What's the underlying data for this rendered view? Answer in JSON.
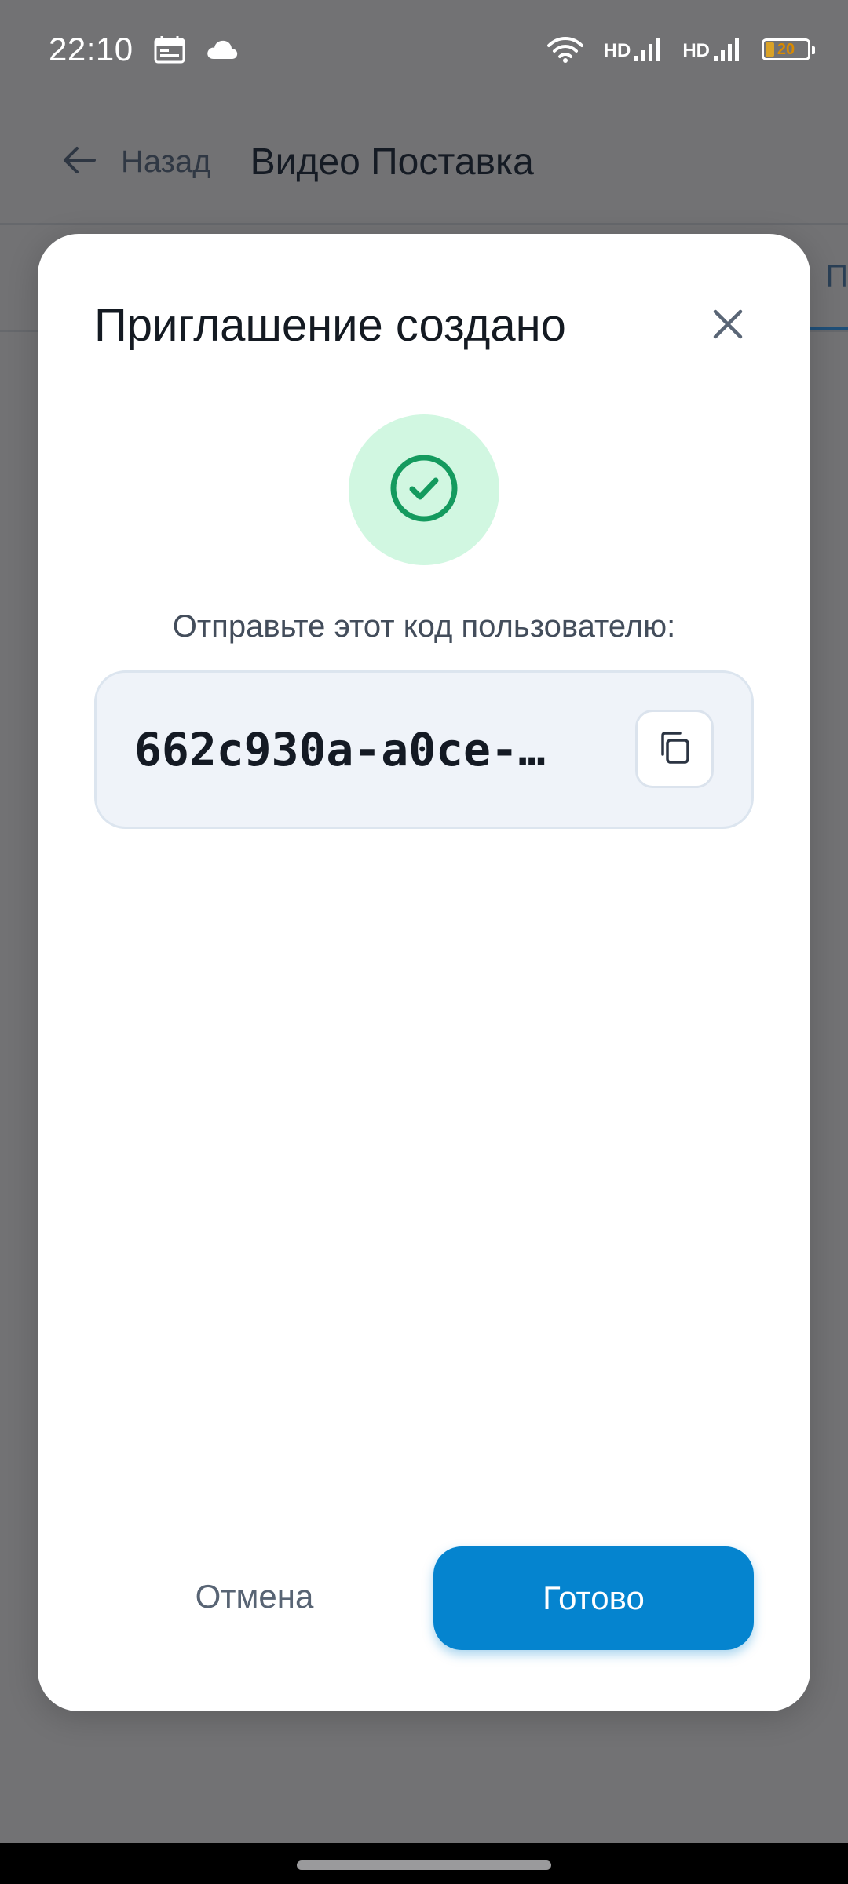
{
  "status_bar": {
    "time": "22:10",
    "network_1": "HD",
    "network_2": "HD",
    "battery_level": "20",
    "icons": [
      "calendar-icon",
      "cloud-icon",
      "wifi-icon",
      "signal-icon",
      "battery-icon"
    ]
  },
  "screen": {
    "back_label": "Назад",
    "title": "Видео Поставка",
    "tab_edge_text": "П"
  },
  "dialog": {
    "title": "Приглашение создано",
    "instruction": "Отправьте этот код пользователю:",
    "code": "662c930a-a0ce-…",
    "cancel_label": "Отмена",
    "done_label": "Готово"
  },
  "colors": {
    "accent": "#0584cf",
    "success_bg": "#d1f7e1",
    "success_fg": "#149a5e",
    "scrim": "#727274"
  }
}
